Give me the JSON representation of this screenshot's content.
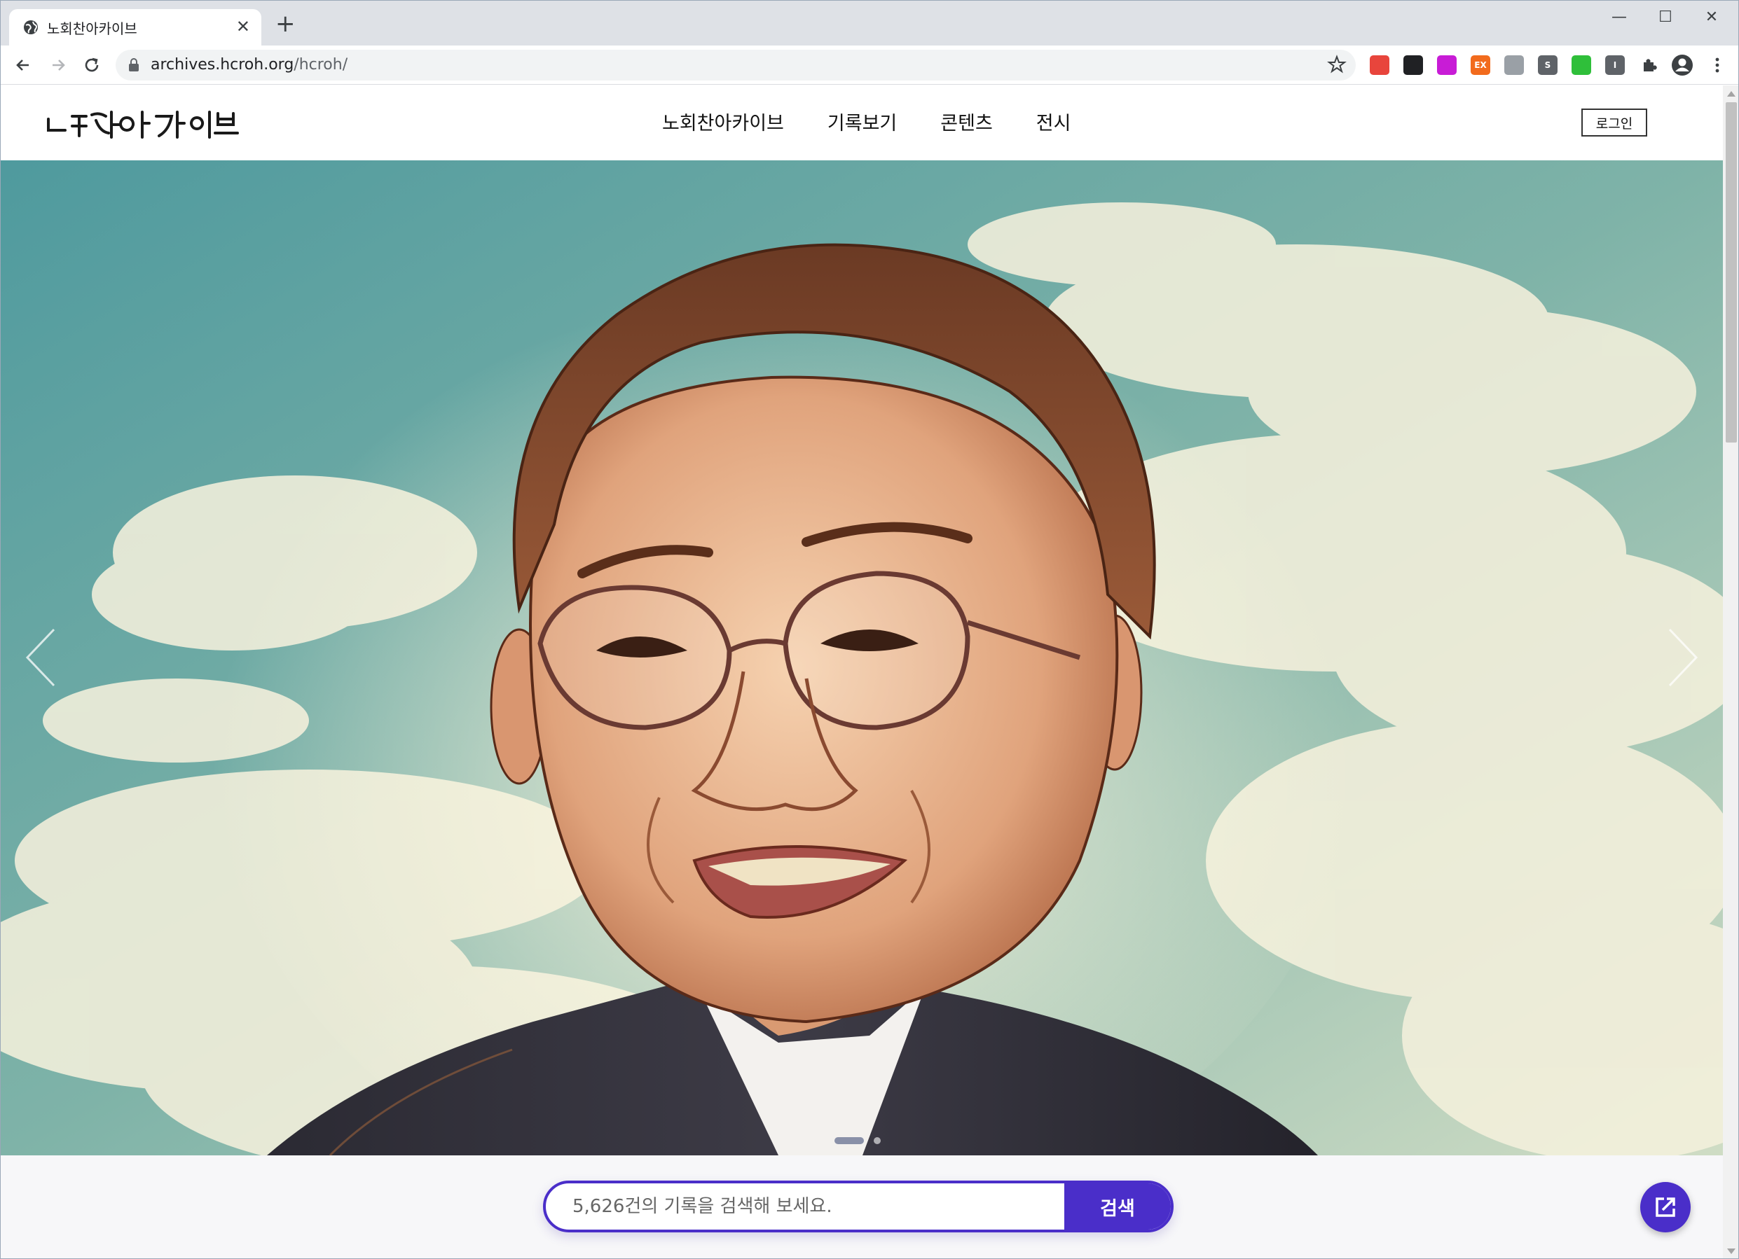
{
  "browser": {
    "tab_title": "노회찬아카이브",
    "url_host": "archives.hcroh.org",
    "url_path": "/hcroh/",
    "extensions": [
      {
        "name": "record-ext",
        "color": "#e8453c",
        "label": ""
      },
      {
        "name": "pdf-ext",
        "color": "#202124",
        "label": ""
      },
      {
        "name": "purple-ext",
        "color": "#c81cd6",
        "label": ""
      },
      {
        "name": "ex-ext",
        "color": "#f26b1d",
        "label": "EX"
      },
      {
        "name": "screen-ext",
        "color": "#9aa0a6",
        "label": ""
      },
      {
        "name": "s-ext",
        "color": "#5f6368",
        "label": "S"
      },
      {
        "name": "green-ext",
        "color": "#2fbf3a",
        "label": ""
      },
      {
        "name": "i-ext",
        "color": "#5f6368",
        "label": "I"
      }
    ]
  },
  "site": {
    "logo_text": "노회찬아카이브",
    "nav": [
      "노회찬아카이브",
      "기록보기",
      "콘텐츠",
      "전시"
    ],
    "login": "로그인"
  },
  "search": {
    "placeholder": "5,626건의 기록을 검색해 보세요.",
    "button": "검색"
  },
  "slider": {
    "slides": 2,
    "active": 1
  },
  "colors": {
    "accent": "#4a2ec9",
    "sky": "#5fa3a4"
  }
}
